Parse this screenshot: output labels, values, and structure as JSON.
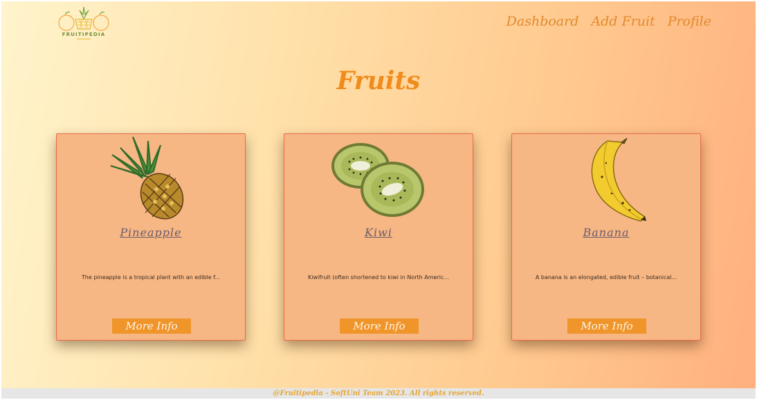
{
  "header": {
    "logo_text": "FRUITIPEDIA",
    "nav": [
      {
        "label": "Dashboard"
      },
      {
        "label": "Add Fruit"
      },
      {
        "label": "Profile"
      }
    ]
  },
  "main": {
    "title": "Fruits",
    "cards": [
      {
        "name": "Pineapple",
        "description": "The pineapple is a tropical plant with an edible f...",
        "button": "More Info",
        "icon": "pineapple-icon"
      },
      {
        "name": "Kiwi",
        "description": "Kiwifruit (often shortened to kiwi in North Americ...",
        "button": "More Info",
        "icon": "kiwi-icon"
      },
      {
        "name": "Banana",
        "description": "A banana is an elongated, edible fruit – botanical...",
        "button": "More Info",
        "icon": "banana-icon"
      }
    ]
  },
  "footer": {
    "text": "@Fruitipedia - SoftUni Team 2023. All rights reserved."
  },
  "colors": {
    "accent": "#f08c1c",
    "card_bg": "#f7b784",
    "button_bg": "#f0952a"
  }
}
